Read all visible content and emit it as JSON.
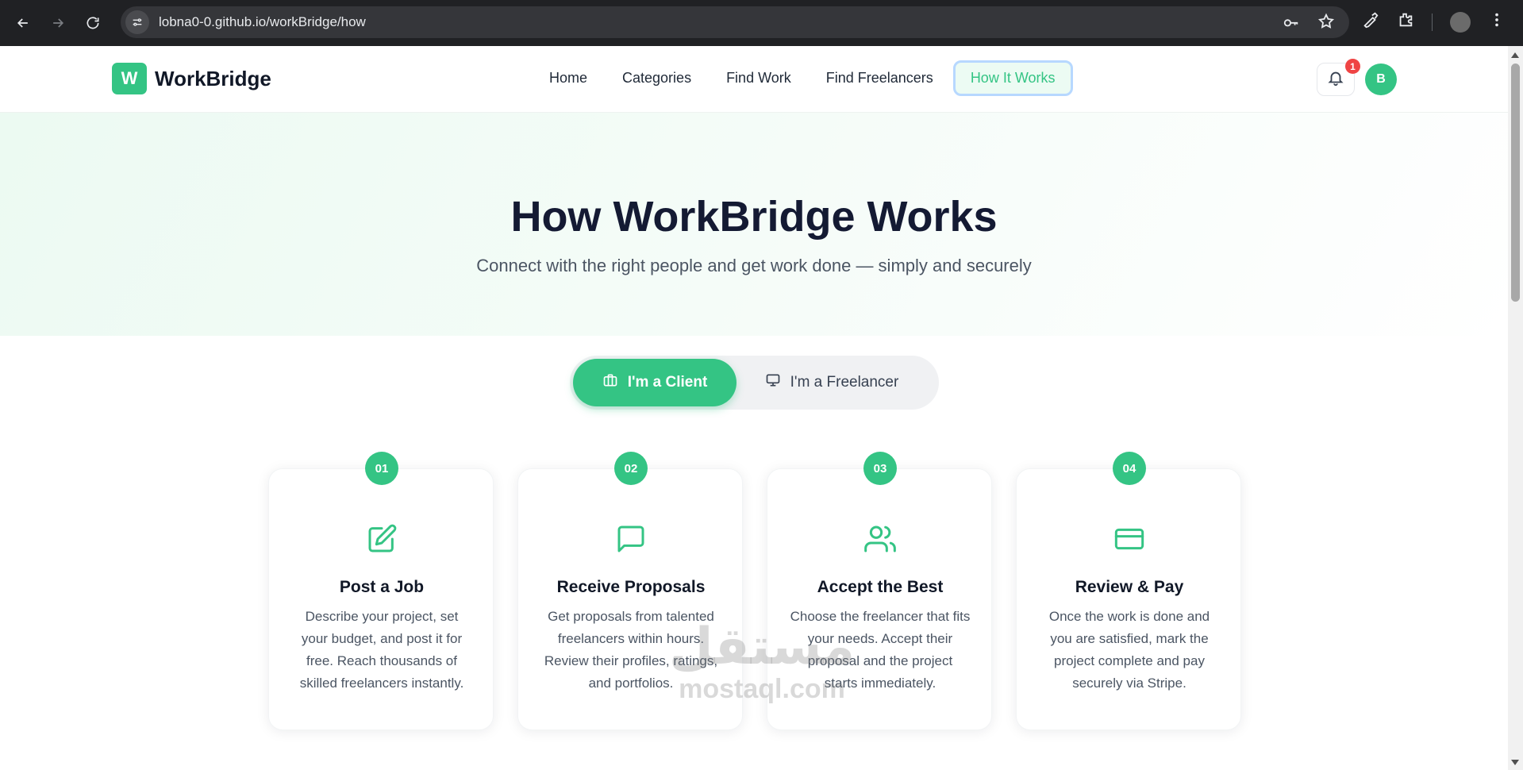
{
  "browser": {
    "url": "lobna0-0.github.io/workBridge/how"
  },
  "header": {
    "logo_mark": "W",
    "logo_text": "WorkBridge",
    "menu": [
      {
        "label": "Home"
      },
      {
        "label": "Categories"
      },
      {
        "label": "Find Work"
      },
      {
        "label": "Find Freelancers"
      },
      {
        "label": "How It Works",
        "active": true
      }
    ],
    "notification_count": "1",
    "avatar_initial": "B"
  },
  "hero": {
    "title": "How WorkBridge Works",
    "subtitle": "Connect with the right people and get work done — simply and securely"
  },
  "toggle": {
    "client_label": "I'm a Client",
    "freelancer_label": "I'm a Freelancer",
    "selected": "client"
  },
  "steps": [
    {
      "number": "01",
      "icon": "edit-icon",
      "title": "Post a Job",
      "description": "Describe your project, set your budget, and post it for free. Reach thousands of skilled freelancers instantly."
    },
    {
      "number": "02",
      "icon": "chat-icon",
      "title": "Receive Proposals",
      "description": "Get proposals from talented freelancers within hours. Review their profiles, ratings, and portfolios."
    },
    {
      "number": "03",
      "icon": "users-icon",
      "title": "Accept the Best",
      "description": "Choose the freelancer that fits your needs. Accept their proposal and the project starts immediately."
    },
    {
      "number": "04",
      "icon": "credit-card-icon",
      "title": "Review & Pay",
      "description": "Once the work is done and you are satisfied, mark the project complete and pay securely via Stripe."
    }
  ],
  "watermark": {
    "arabic": "مستقل",
    "latin": "mostaql.com"
  },
  "colors": {
    "accent": "#34c484",
    "heading": "#141a33",
    "badge": "#ef4444"
  }
}
